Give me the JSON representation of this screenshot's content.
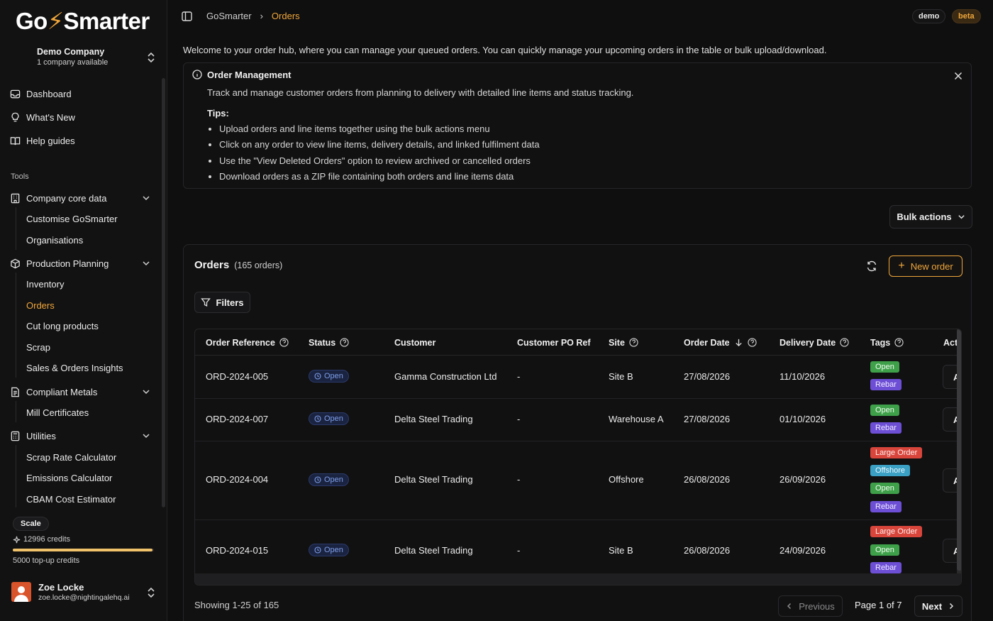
{
  "brand": {
    "logo_left": "Go",
    "logo_bolt": "⚡",
    "logo_right": "Smarter",
    "accent": "#f0a63a"
  },
  "company": {
    "name": "Demo Company",
    "sub": "1 company available"
  },
  "nav": {
    "dashboard": "Dashboard",
    "whats_new": "What's New",
    "help": "Help guides",
    "tools_label": "Tools",
    "company_core": "Company core data",
    "customise": "Customise GoSmarter",
    "organisations": "Organisations",
    "production": "Production Planning",
    "inventory": "Inventory",
    "orders": "Orders",
    "cut_long": "Cut long products",
    "scrap": "Scrap",
    "sales_insights": "Sales & Orders Insights",
    "compliant": "Compliant Metals",
    "mill": "Mill Certificates",
    "utilities": "Utilities",
    "scrap_rate": "Scrap Rate Calculator",
    "emissions": "Emissions Calculator",
    "cbam": "CBAM Cost Estimator"
  },
  "plan": {
    "badge": "Scale",
    "credits": "12996 credits",
    "credit_fraction": 0.99,
    "topup": "5000 top-up credits"
  },
  "user": {
    "name": "Zoe Locke",
    "email": "zoe.locke@nightingalehq.ai"
  },
  "breadcrumb": {
    "root": "GoSmarter",
    "sep": "›",
    "current": "Orders"
  },
  "pills": {
    "demo": "demo",
    "beta": "beta"
  },
  "welcome": "Welcome to your order hub, where you can manage your queued orders. You can quickly manage your upcoming orders in the table or bulk upload/download.",
  "info": {
    "title": "Order Management",
    "desc": "Track and manage customer orders from planning to delivery with detailed line items and status tracking.",
    "tips_label": "Tips:",
    "tips": [
      "Upload orders and line items together using the bulk actions menu",
      "Click on any order to view line items, delivery details, and linked fulfilment data",
      "Use the \"View Deleted Orders\" option to review archived or cancelled orders",
      "Download orders as a ZIP file containing both orders and line items data"
    ]
  },
  "bulk_actions": "Bulk actions",
  "orders": {
    "title": "Orders",
    "count": "(165 orders)",
    "new_order": "New order",
    "filters": "Filters",
    "columns": {
      "ref": "Order Reference",
      "status": "Status",
      "customer": "Customer",
      "po": "Customer PO Ref",
      "site": "Site",
      "order_date": "Order Date",
      "delivery": "Delivery Date",
      "tags": "Tags",
      "actions": "Act"
    },
    "rows": [
      {
        "ref": "ORD-2024-005",
        "status": "Open",
        "customer": "Gamma Construction Ltd",
        "po": "-",
        "site": "Site B",
        "order_date": "27/08/2026",
        "delivery": "11/10/2026",
        "tags": [
          "Open",
          "Rebar"
        ],
        "action": "A"
      },
      {
        "ref": "ORD-2024-007",
        "status": "Open",
        "customer": "Delta Steel Trading",
        "po": "-",
        "site": "Warehouse A",
        "order_date": "27/08/2026",
        "delivery": "01/10/2026",
        "tags": [
          "Open",
          "Rebar"
        ],
        "action": "A"
      },
      {
        "ref": "ORD-2024-004",
        "status": "Open",
        "customer": "Delta Steel Trading",
        "po": "-",
        "site": "Offshore",
        "order_date": "26/08/2026",
        "delivery": "26/09/2026",
        "tags": [
          "Large Order",
          "Offshore",
          "Open",
          "Rebar"
        ],
        "action": "A"
      },
      {
        "ref": "ORD-2024-015",
        "status": "Open",
        "customer": "Delta Steel Trading",
        "po": "-",
        "site": "Site B",
        "order_date": "26/08/2026",
        "delivery": "24/09/2026",
        "tags": [
          "Large Order",
          "Open",
          "Rebar"
        ],
        "action": "A"
      }
    ],
    "showing": "Showing 1-25 of 165",
    "previous": "Previous",
    "page": "Page 1 of 7",
    "next": "Next"
  }
}
